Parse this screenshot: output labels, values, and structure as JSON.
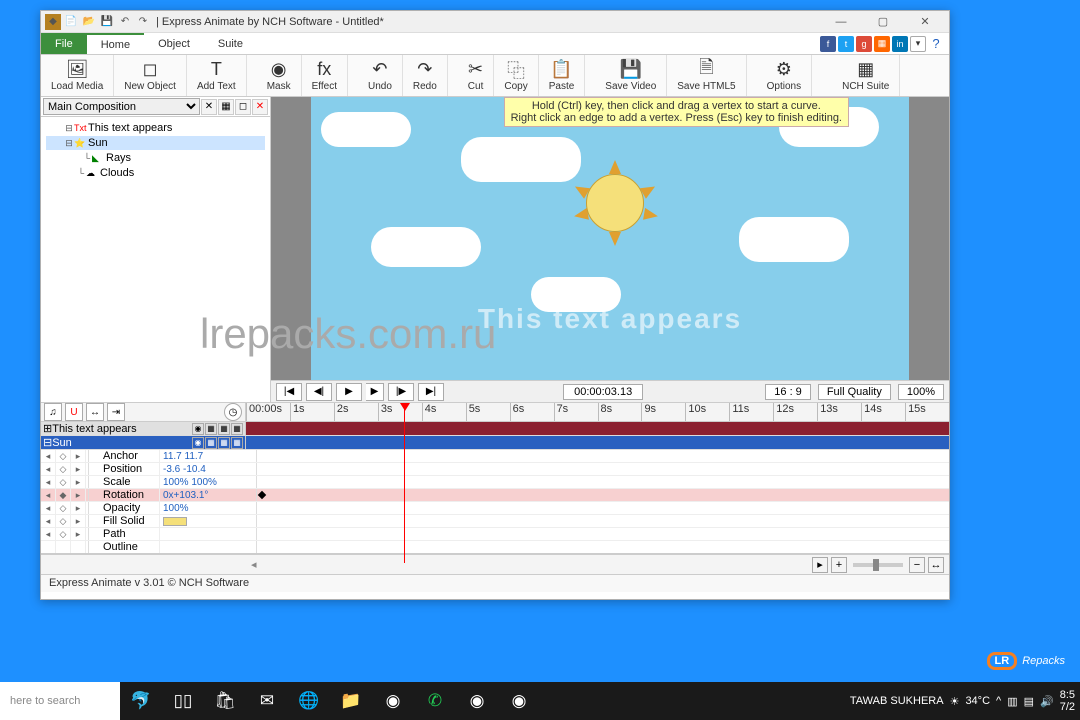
{
  "title": "|  Express Animate by NCH Software - Untitled*",
  "menu": {
    "file": "File",
    "home": "Home",
    "object": "Object",
    "suite": "Suite"
  },
  "ribbon": {
    "load": "Load Media",
    "newobj": "New Object",
    "addtext": "Add Text",
    "mask": "Mask",
    "effect": "Effect",
    "undo": "Undo",
    "redo": "Redo",
    "cut": "Cut",
    "copy": "Copy",
    "paste": "Paste",
    "savevid": "Save Video",
    "savehtml": "Save HTML5",
    "options": "Options",
    "nch": "NCH Suite"
  },
  "comp": "Main Composition",
  "tree": {
    "t1": "This text appears",
    "t2": "Sun",
    "t3": "Rays",
    "t4": "Clouds"
  },
  "hint1": "Hold (Ctrl) key, then click and drag a vertex to start a curve.",
  "hint2": "Right click an edge to add a vertex. Press (Esc) key to finish editing.",
  "canvastext": "This text appears",
  "play": {
    "tc": "00:00:03.13",
    "ratio": "16 : 9",
    "quality": "Full Quality",
    "zoom": "100%"
  },
  "ruler": [
    "00:00s",
    "1s",
    "2s",
    "3s",
    "4s",
    "5s",
    "6s",
    "7s",
    "8s",
    "9s",
    "10s",
    "11s",
    "12s",
    "13s",
    "14s",
    "15s"
  ],
  "track1": "This text appears",
  "track2": "Sun",
  "props": {
    "anchor": {
      "n": "Anchor",
      "v": "11.7  11.7"
    },
    "position": {
      "n": "Position",
      "v": "-3.6  -10.4"
    },
    "scale": {
      "n": "Scale",
      "v": "100%  100%"
    },
    "rotation": {
      "n": "Rotation",
      "v": "0x+103.1°"
    },
    "opacity": {
      "n": "Opacity",
      "v": "100%"
    },
    "fill": {
      "n": "Fill Solid",
      "v": ""
    },
    "path": {
      "n": "Path",
      "v": ""
    },
    "outline": {
      "n": "Outline",
      "v": ""
    }
  },
  "status": "Express Animate v 3.01 © NCH Software",
  "taskbar": {
    "search": "here to search",
    "user": "TAWAB SUKHERA",
    "temp": "34°C",
    "time": "8:5",
    "date": "7/2"
  },
  "watermark": "lrepacks.com.ru",
  "logo": "Repacks"
}
